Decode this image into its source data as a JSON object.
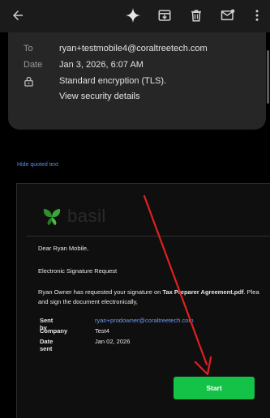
{
  "toolbar": {
    "icons": [
      "back-arrow-icon",
      "sparkle-icon",
      "archive-icon",
      "delete-icon",
      "mark-unread-icon",
      "more-vert-icon"
    ]
  },
  "details": {
    "to_label": "To",
    "to_value": "ryan+testmobile4@coraltreetech.com",
    "date_label": "Date",
    "date_value": "Jan 3, 2026, 6:07 AM",
    "encryption_value": "Standard encryption (TLS).",
    "security_link": "View security details"
  },
  "hide_quoted": "Hide quoted text",
  "email": {
    "logo_text": "basil",
    "greeting": "Dear Ryan Mobile,",
    "heading": "Electronic Signature Request",
    "body_prefix": "Ryan Owner has requested your signature on ",
    "body_document": "Tax Preparer Agreement.pdf",
    "body_suffix": ". Plea",
    "body_line2": "and sign the document electronically,",
    "fields": [
      {
        "key": "Sent by",
        "value": "ryan+prodowner@coraltreetech.com"
      },
      {
        "key": "Company",
        "value": "Test4"
      },
      {
        "key": "Date sent",
        "value": "Jan 02, 2026"
      }
    ],
    "start_label": "Start"
  },
  "colors": {
    "accent_button": "#15c248",
    "link": "#6d9cf5",
    "annotation_arrow": "#e02020"
  }
}
